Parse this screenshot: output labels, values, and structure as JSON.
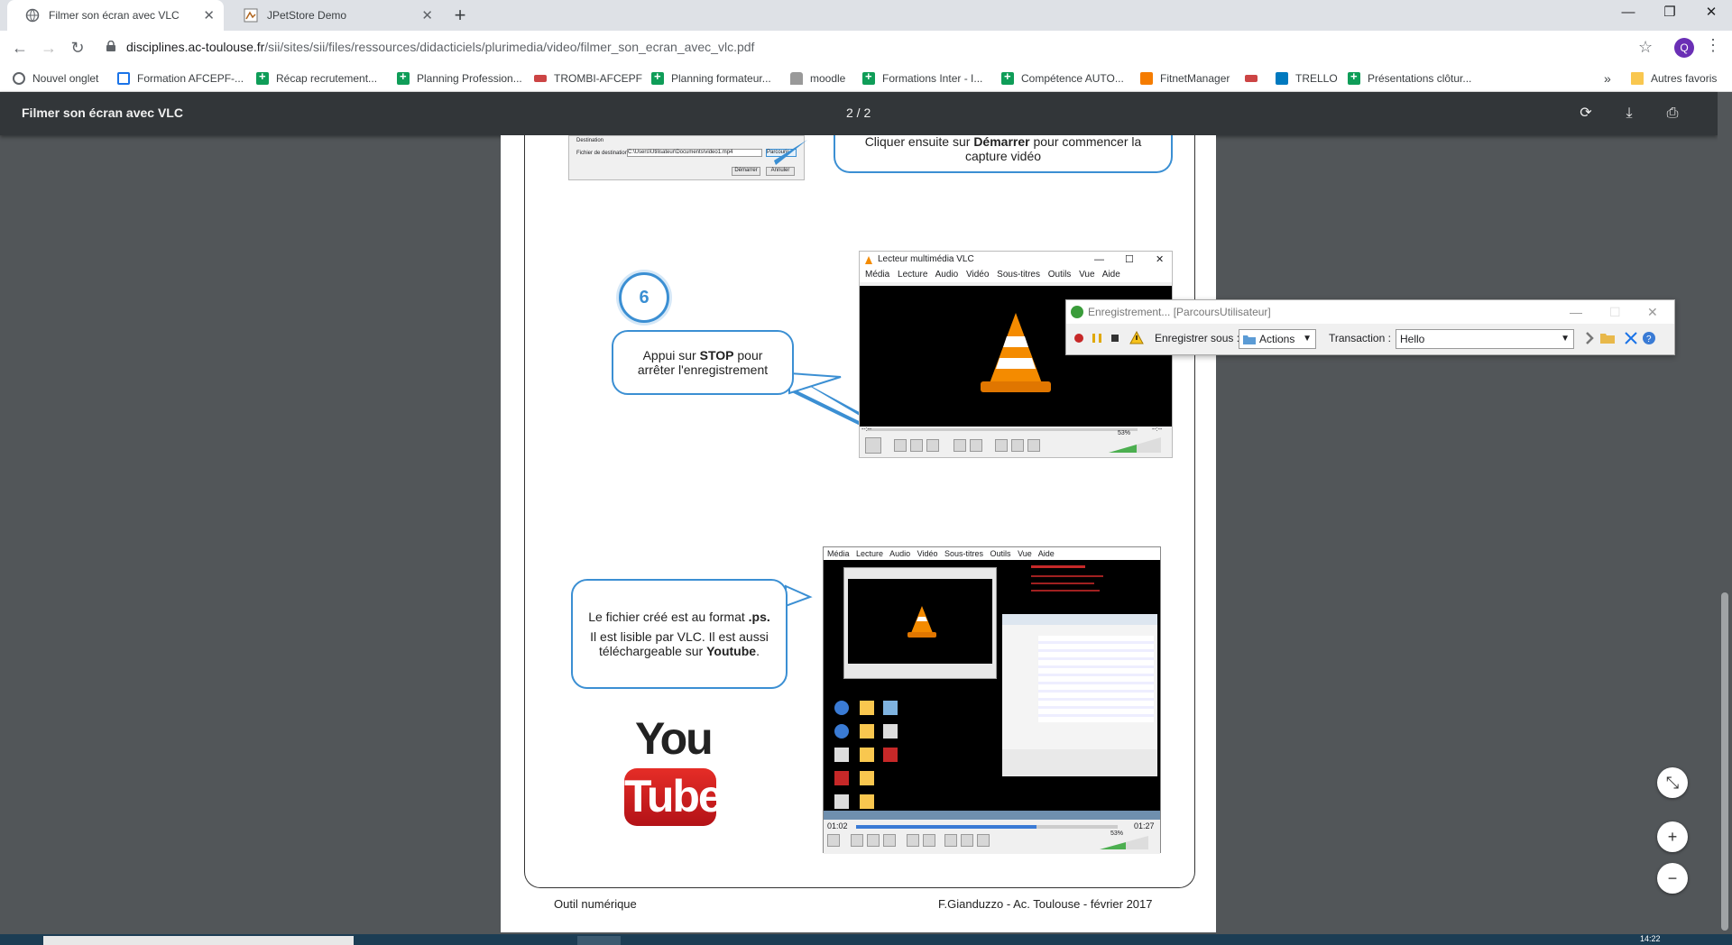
{
  "browser": {
    "tabs": [
      {
        "title": "Filmer son écran avec VLC",
        "active": true
      },
      {
        "title": "JPetStore Demo",
        "active": false
      }
    ],
    "url_host": "disciplines.ac-toulouse.fr",
    "url_path": "/sii/sites/sii/files/ressources/didacticiels/plurimedia/video/filmer_son_ecran_avec_vlc.pdf",
    "profile_initial": "Q",
    "bookmarks": [
      {
        "label": "Nouvel onglet",
        "icon": "globe-icon"
      },
      {
        "label": "Formation AFCEPF-...",
        "icon": "doc-icon"
      },
      {
        "label": "Récap recrutement...",
        "icon": "sheets-icon"
      },
      {
        "label": "Planning Profession...",
        "icon": "sheets-icon"
      },
      {
        "label": "TROMBI-AFCEPF",
        "icon": "mail-icon"
      },
      {
        "label": "Planning formateur...",
        "icon": "sheets-icon"
      },
      {
        "label": "moodle",
        "icon": "moodle-icon"
      },
      {
        "label": "Formations Inter - I...",
        "icon": "sheets-icon"
      },
      {
        "label": "Compétence AUTO...",
        "icon": "sheets-icon"
      },
      {
        "label": "FitnetManager",
        "icon": "fitnet-icon"
      },
      {
        "label": "",
        "icon": "mail-icon"
      },
      {
        "label": "TRELLO",
        "icon": "trello-icon"
      },
      {
        "label": "Présentations clôtur...",
        "icon": "sheets-icon"
      }
    ],
    "bookmarks_overflow": "»",
    "other_bookmarks": "Autres favoris"
  },
  "pdf": {
    "title": "Filmer son écran avec VLC",
    "page_indicator": "2 / 2",
    "top_snippet": {
      "label_destination": "Destination",
      "label_file": "Fichier de destination :",
      "file_value": "C:\\Users\\Utilisateur\\Documents\\video1.mp4",
      "btn_parcourir": "Parcourir",
      "btn_demarrer": "Démarrer",
      "btn_annuler": "Annuler",
      "bubble_line1_pre": "Cliquer ensuite sur ",
      "bubble_line1_bold": "Démarrer",
      "bubble_line1_post": " pour commencer la",
      "bubble_line2": "capture vidéo"
    },
    "step_number": "6",
    "stop_bubble": {
      "pre": "Appui sur ",
      "bold": "STOP",
      "post": " pour",
      "line2": "arrêter l'enregistrement"
    },
    "vlc_window": {
      "title": "Lecteur multimédia VLC",
      "menu": [
        "Média",
        "Lecture",
        "Audio",
        "Vidéo",
        "Sous-titres",
        "Outils",
        "Vue",
        "Aide"
      ],
      "volume": "53%",
      "time_left": "--:--",
      "time_right": "--:--"
    },
    "recorder": {
      "title": "Enregistrement... [ParcoursUtilisateur]",
      "save_label": "Enregistrer sous :",
      "actions_value": "Actions",
      "transaction_label": "Transaction :",
      "transaction_value": "Hello"
    },
    "format_bubble": {
      "line1_pre": "Le fichier créé est au format ",
      "line1_bold": ".ps.",
      "line2": "Il est lisible par VLC. Il est aussi",
      "line3_pre": "téléchargeable sur ",
      "line3_bold": "Youtube",
      "line3_post": "."
    },
    "vlc2": {
      "menu": [
        "Média",
        "Lecture",
        "Audio",
        "Vidéo",
        "Sous-titres",
        "Outils",
        "Vue",
        "Aide"
      ],
      "time_start": "01:02",
      "time_end": "01:27",
      "progress": 0.69,
      "volume": "53%"
    },
    "youtube_logo": {
      "you": "You",
      "tube": "Tube"
    },
    "footer_left": "Outil numérique",
    "footer_right": "F.Gianduzzo - Ac. Toulouse - février 2017"
  },
  "taskbar": {
    "clock": "14:22"
  }
}
